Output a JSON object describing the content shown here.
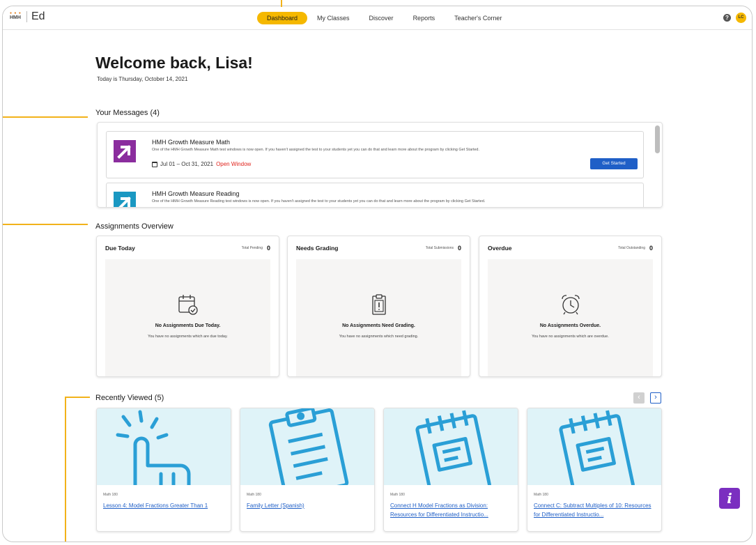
{
  "app": {
    "logo_text": "HMH",
    "logo_dots": "● ● ●",
    "product": "Ed"
  },
  "nav": {
    "items": [
      {
        "label": "Dashboard",
        "active": true
      },
      {
        "label": "My Classes",
        "active": false
      },
      {
        "label": "Discover",
        "active": false
      },
      {
        "label": "Reports",
        "active": false
      },
      {
        "label": "Teacher's Corner",
        "active": false
      }
    ],
    "help_icon": "?",
    "avatar_initials": "LC"
  },
  "welcome": {
    "heading": "Welcome back, Lisa!",
    "today": "Today is Thursday, October 14, 2021"
  },
  "messages": {
    "title": "Your Messages (4)",
    "items": [
      {
        "title": "HMH Growth Measure Math",
        "description": "One of the HMH Growth Measure Math test windows is now open. If you haven't assigned the test to your students yet you can do that and learn more about the program by clicking Get Started.",
        "date_range": "Jul 01 – Oct 31, 2021",
        "status": "Open Window",
        "button": "Get Started",
        "icon_color": "#8b2d9e"
      },
      {
        "title": "HMH Growth Measure Reading",
        "description": "One of the HMH Growth Measure Reading test windows is now open. If you haven't assigned the test to your students yet you can do that and learn more about the program by clicking Get Started.",
        "icon_color": "#1a98c2"
      }
    ]
  },
  "assignments": {
    "title": "Assignments Overview",
    "cards": [
      {
        "title": "Due Today",
        "meta_label": "Total Pending",
        "count": "0",
        "icon": "calendar-check-icon",
        "empty_title": "No Assignments Due Today.",
        "empty_sub": "You have no assignments which are due today."
      },
      {
        "title": "Needs Grading",
        "meta_label": "Total Submissions",
        "count": "0",
        "icon": "clipboard-icon",
        "empty_title": "No Assignments Need Grading.",
        "empty_sub": "You have no assignments which need grading."
      },
      {
        "title": "Overdue",
        "meta_label": "Total Outstanding",
        "count": "0",
        "icon": "alarm-clock-icon",
        "empty_title": "No Assignments Overdue.",
        "empty_sub": "You have no assignments which are overdue."
      }
    ]
  },
  "recent": {
    "title": "Recently Viewed (5)",
    "prev": "‹",
    "next": "›",
    "items": [
      {
        "category": "Math 180",
        "title": "Lesson 4: Model Fractions Greater Than 1",
        "illustration": "pointing-hand-icon"
      },
      {
        "category": "Math 180",
        "title": "Family Letter (Spanish)",
        "illustration": "clipboard-icon"
      },
      {
        "category": "Math 180",
        "title": "Connect H Model Fractions as Division: Resources for Differentiated Instructio...",
        "illustration": "notepad-icon"
      },
      {
        "category": "Math 180",
        "title": "Connect C: Subtract Multiples of 10: Resources for Differentiated Instructio...",
        "illustration": "notepad-icon"
      }
    ]
  },
  "info_button": "i",
  "colors": {
    "accent": "#f5b800",
    "link": "#1f5fc7",
    "alert": "#e0231c",
    "annotation": "#f2b21a"
  }
}
